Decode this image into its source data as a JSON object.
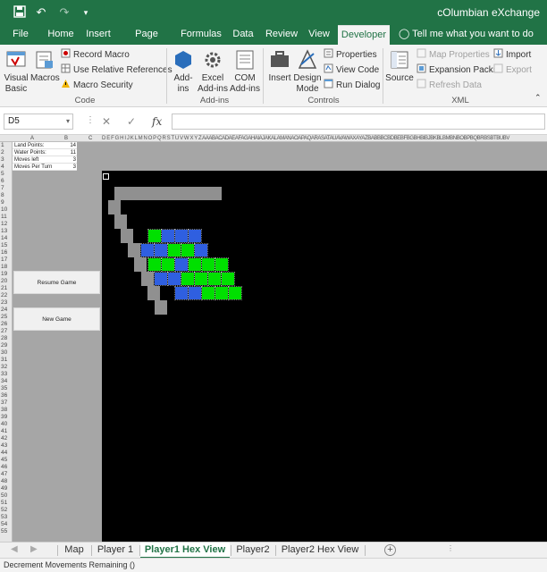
{
  "window": {
    "title": "cOlumbian eXchange"
  },
  "quick_access": {
    "save": "save-icon",
    "undo": "undo-icon",
    "redo": "redo-icon",
    "customize": "dropdown-icon"
  },
  "ribbon_tabs": [
    "File",
    "Home",
    "Insert",
    "Page Layout",
    "Formulas",
    "Data",
    "Review",
    "View",
    "Developer"
  ],
  "active_tab": "Developer",
  "tell_me": "Tell me what you want to do",
  "ribbon": {
    "code": {
      "label": "Code",
      "visual_basic": "Visual Basic",
      "macros": "Macros",
      "record_macro": "Record Macro",
      "relative_refs": "Use Relative References",
      "macro_security": "Macro Security"
    },
    "addins": {
      "label": "Add-ins",
      "addins": "Add-ins",
      "excel_addins": "Excel Add-ins",
      "com_addins": "COM Add-ins"
    },
    "controls": {
      "label": "Controls",
      "insert": "Insert",
      "design_mode": "Design Mode",
      "properties": "Properties",
      "view_code": "View Code",
      "run_dialog": "Run Dialog"
    },
    "xml": {
      "label": "XML",
      "source": "Source",
      "map_properties": "Map Properties",
      "expansion_packs": "Expansion Packs",
      "refresh_data": "Refresh Data",
      "import": "Import",
      "export": "Export"
    }
  },
  "formula_bar": {
    "name_box": "D5",
    "formula": "",
    "fx": "fx"
  },
  "columns": [
    "A",
    "B",
    "C"
  ],
  "rows": [
    "1",
    "2",
    "3",
    "4",
    "5",
    "6",
    "7",
    "8",
    "9",
    "10",
    "11",
    "12",
    "13",
    "14",
    "15",
    "16",
    "17",
    "18",
    "19",
    "20",
    "21",
    "22",
    "23",
    "24",
    "25",
    "26",
    "27",
    "28",
    "29",
    "30",
    "31",
    "32",
    "33",
    "34",
    "35",
    "36",
    "37",
    "38",
    "39",
    "40",
    "41",
    "42",
    "43",
    "44",
    "45",
    "46",
    "47",
    "48",
    "49",
    "50",
    "51",
    "52",
    "53",
    "54",
    "55"
  ],
  "stats": [
    {
      "label": "Land Points:",
      "value": "14"
    },
    {
      "label": "Water Points:",
      "value": "11"
    },
    {
      "label": "Moves left",
      "value": "3"
    },
    {
      "label": "Moves Per Turn",
      "value": "3"
    }
  ],
  "buttons": {
    "resume": "Resume Game",
    "new_game": "New Game"
  },
  "colors": {
    "land": "#00e000",
    "water": "#2f5fe0",
    "path": "#909090",
    "background": "#000000",
    "excel_green": "#217346"
  },
  "sheet_tabs": [
    "Map",
    "Player 1",
    "Player1 Hex View",
    "Player2",
    "Player2 Hex View"
  ],
  "active_sheet": "Player1 Hex View",
  "status": "Decrement Movements Remaining ()"
}
